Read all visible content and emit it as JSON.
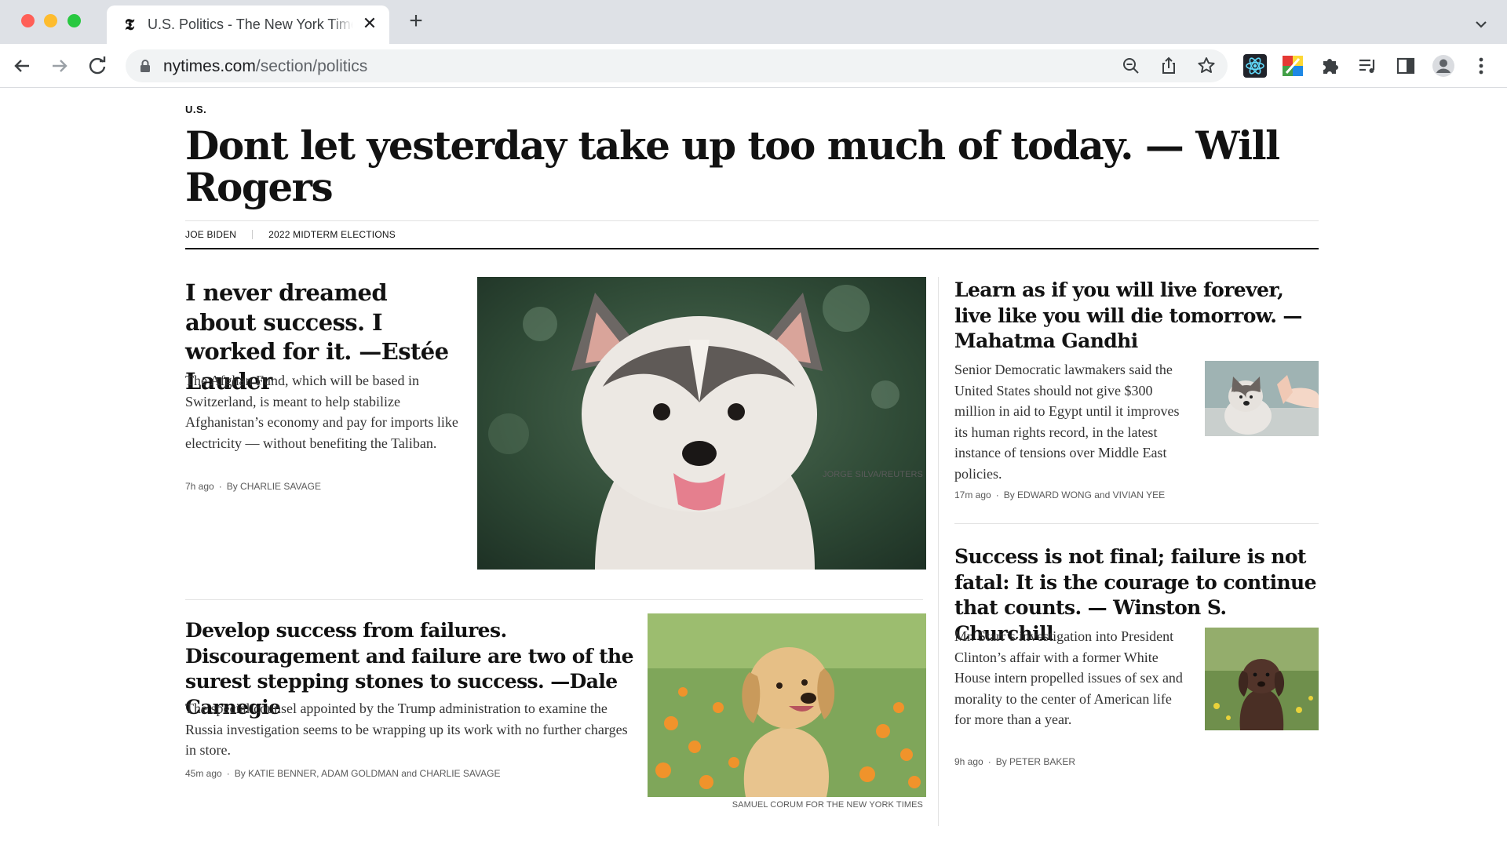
{
  "browser": {
    "tab_title": "U.S. Politics - The New York Times",
    "tab_favicon": "𝕿",
    "url_host": "nytimes.com",
    "url_path": "/section/politics"
  },
  "page": {
    "kicker": "U.S.",
    "headline": "Dont let yesterday take up too much of today. — Will Rogers",
    "sub_nav": [
      "JOE BIDEN",
      "2022 MIDTERM ELECTIONS"
    ]
  },
  "stories": {
    "lead": {
      "title": "I never dreamed about success. I worked for it. —Estée Lauder",
      "summary": "The Afghan Fund, which will be based in Switzerland, is meant to help stabilize Afghanistan’s economy and pay for imports like electricity — without benefiting the Taliban.",
      "time": "7h ago",
      "byline": "By CHARLIE SAVAGE",
      "image_alt": "husky puppy",
      "credit": "JORGE SILVA/REUTERS"
    },
    "second": {
      "title": "Develop success from failures. Discouragement and failure are two of the surest stepping stones to success. —Dale Carnegie",
      "summary": "The special counsel appointed by the Trump administration to examine the Russia investigation seems to be wrapping up its work with no further charges in store.",
      "time": "45m ago",
      "byline": "By KATIE BENNER, ADAM GOLDMAN and CHARLIE SAVAGE",
      "image_alt": "golden retriever puppy",
      "credit": "SAMUEL CORUM FOR THE NEW YORK TIMES"
    },
    "right1": {
      "title": "Learn as if you will live forever, live like you will die tomorrow. — Mahatma Gandhi",
      "summary": "Senior Democratic lawmakers said the United States should not give $300 million in aid to Egypt until it improves its human rights record, in the latest instance of tensions over Middle East policies.",
      "time": "17m ago",
      "byline": "By EDWARD WONG and VIVIAN YEE",
      "image_alt": "husky puppy high five"
    },
    "right2": {
      "title": "Success is not final; failure is not fatal: It is the courage to continue that counts. — Winston S. Churchill",
      "summary": "Mr. Starr’s investigation into President Clinton’s affair with a former White House intern propelled issues of sex and morality to the center of American life for more than a year.",
      "time": "9h ago",
      "byline": "By PETER BAKER",
      "image_alt": "chocolate puppy"
    }
  },
  "meta_separator": "·",
  "colors": {
    "tabbar_bg": "#dee1e6",
    "omnibox_bg": "#f1f3f4",
    "text": "#121212",
    "rule": "#e2e2e2"
  }
}
